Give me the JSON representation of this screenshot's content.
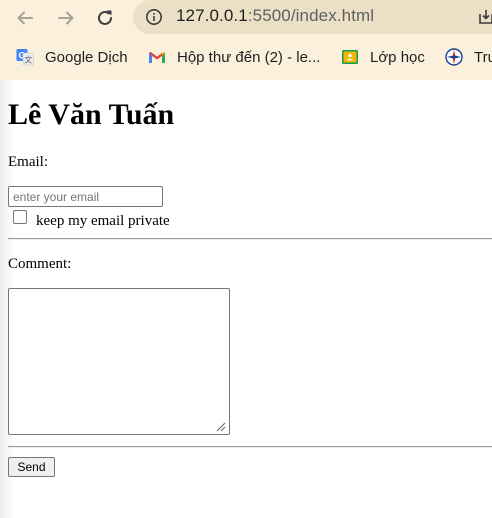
{
  "browser": {
    "url_host": "127.0.0.1",
    "url_port_path": ":5500/index.html",
    "bookmarks": [
      {
        "label": "Google Dịch",
        "icon": "google-translate-icon"
      },
      {
        "label": "Hộp thư đến (2) - le...",
        "icon": "gmail-icon"
      },
      {
        "label": "Lớp học",
        "icon": "google-classroom-icon"
      },
      {
        "label": "Tru",
        "icon": "compass-icon"
      }
    ]
  },
  "page": {
    "heading": "Lê Văn Tuấn",
    "email_label": "Email:",
    "email_placeholder": "enter your email",
    "email_value": "",
    "private_checkbox_label": "keep my email private",
    "private_checked": false,
    "comment_label": "Comment:",
    "comment_value": "",
    "send_label": "Send"
  }
}
